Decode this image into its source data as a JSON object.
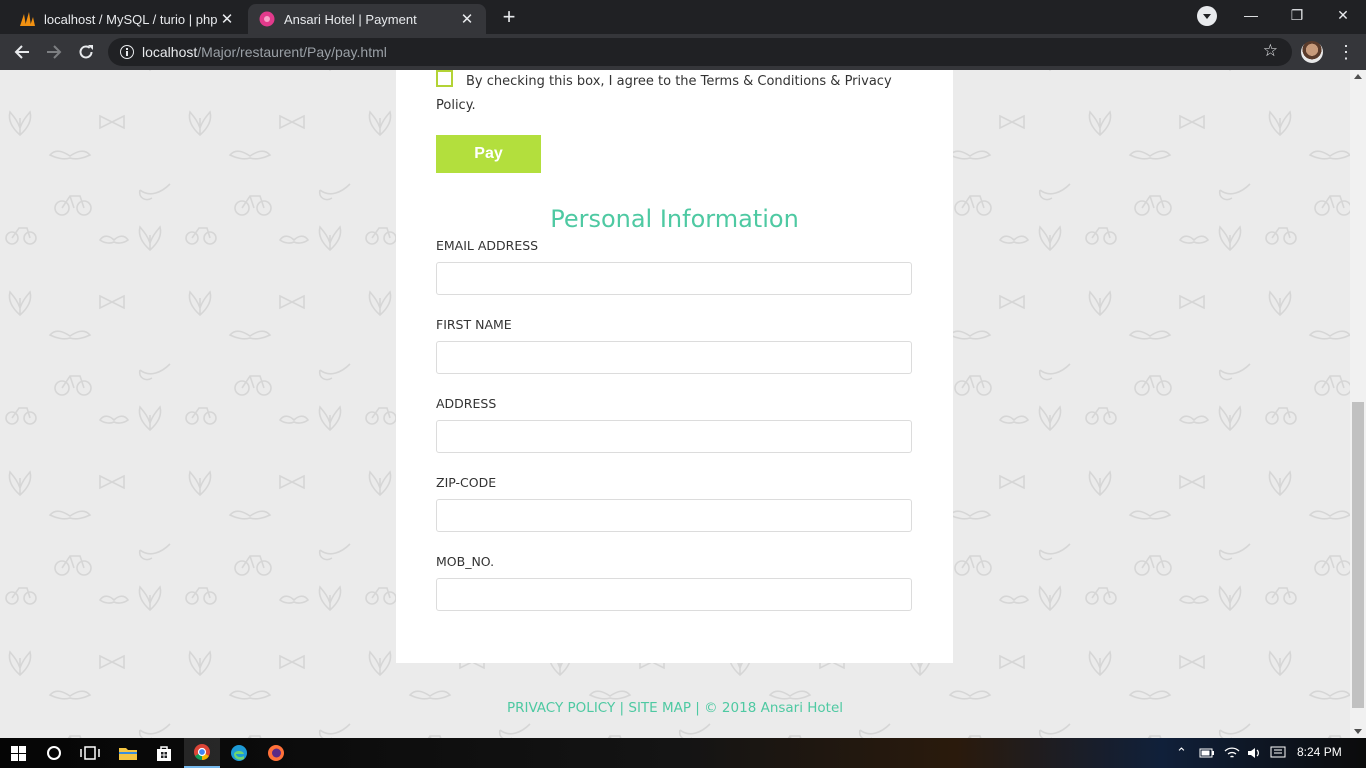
{
  "browser": {
    "tabs": [
      {
        "title": "localhost / MySQL / turio | phpMyAdmin",
        "favicon": "phpmyadmin-icon",
        "active": false
      },
      {
        "title": "Ansari Hotel | Payment",
        "favicon": "site-favicon-icon",
        "active": true
      }
    ],
    "url_host": "localhost",
    "url_path": "/Major/restaurent/Pay/pay.html"
  },
  "page": {
    "agree_text": "By checking this box, I agree to the Terms & Conditions & Privacy Policy.",
    "pay_label": "Pay",
    "section_title": "Personal Information",
    "fields": [
      {
        "label": "EMAIL ADDRESS",
        "value": ""
      },
      {
        "label": "FIRST NAME",
        "value": ""
      },
      {
        "label": "ADDRESS",
        "value": ""
      },
      {
        "label": "ZIP-CODE",
        "value": ""
      },
      {
        "label": "MOB_NO.",
        "value": ""
      }
    ],
    "footer": "PRIVACY POLICY | SITE MAP | © 2018 Ansari Hotel"
  },
  "colors": {
    "accent_green": "#b3df3d",
    "teal": "#4ec9a2",
    "background": "#ebebeb"
  },
  "taskbar": {
    "pinned": [
      "start-icon",
      "search-icon",
      "task-view-icon",
      "file-explorer-icon",
      "store-icon",
      "chrome-icon",
      "edge-icon",
      "firefox-icon"
    ],
    "clock": "8:24 PM"
  }
}
